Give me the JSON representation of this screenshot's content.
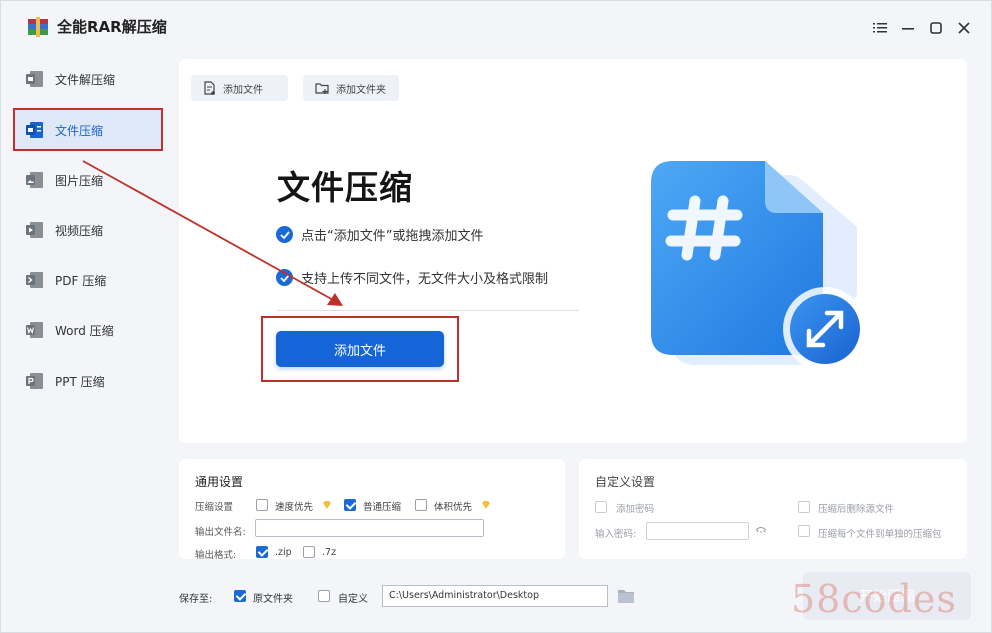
{
  "app": {
    "title": "全能RAR解压缩"
  },
  "window_controls": {
    "menu_icon": "menu-icon",
    "min_icon": "minimize-icon",
    "max_icon": "maximize-icon",
    "close_icon": "close-icon"
  },
  "sidebar": {
    "items": [
      {
        "label": "文件解压缩",
        "icon": "unzip-icon"
      },
      {
        "label": "文件压缩",
        "icon": "zip-file-icon",
        "active": true
      },
      {
        "label": "图片压缩",
        "icon": "image-icon"
      },
      {
        "label": "视频压缩",
        "icon": "video-icon"
      },
      {
        "label": "PDF 压缩",
        "icon": "pdf-icon"
      },
      {
        "label": "Word 压缩",
        "icon": "word-icon"
      },
      {
        "label": "PPT 压缩",
        "icon": "ppt-icon"
      }
    ]
  },
  "toolbar": {
    "add_file": "添加文件",
    "add_folder": "添加文件夹"
  },
  "hero": {
    "title": "文件压缩",
    "feature_1": "点击“添加文件”或拖拽添加文件",
    "feature_2": "支持上传不同文件，无文件大小及格式限制",
    "button": "添加文件"
  },
  "general_settings": {
    "title": "通用设置",
    "compress_label": "压缩设置",
    "options": [
      {
        "label": "速度优先",
        "checked": false
      },
      {
        "label": "普通压缩",
        "checked": true
      },
      {
        "label": "体积优先",
        "checked": false
      }
    ],
    "output_name_label": "输出文件名:",
    "output_name_value": "",
    "output_format_label": "输出格式:",
    "formats": [
      {
        "label": ".zip",
        "checked": true
      },
      {
        "label": ".7z",
        "checked": false
      }
    ]
  },
  "custom_settings": {
    "title": "自定义设置",
    "add_password": "添加密码",
    "password_label": "输入密码:",
    "password_value": "",
    "delete_source": "压缩后删除源文件",
    "separate_archives": "压缩每个文件到单独的压缩包"
  },
  "bottom": {
    "save_to": "保存至:",
    "source_folder": "原文件夹",
    "source_folder_checked": true,
    "custom": "自定义",
    "custom_checked": false,
    "path": "C:\\Users\\Administrator\\Desktop",
    "start_button": "开始压缩"
  },
  "watermark": "58codes",
  "colors": {
    "accent": "#1665d8",
    "highlight": "#c0302a"
  }
}
